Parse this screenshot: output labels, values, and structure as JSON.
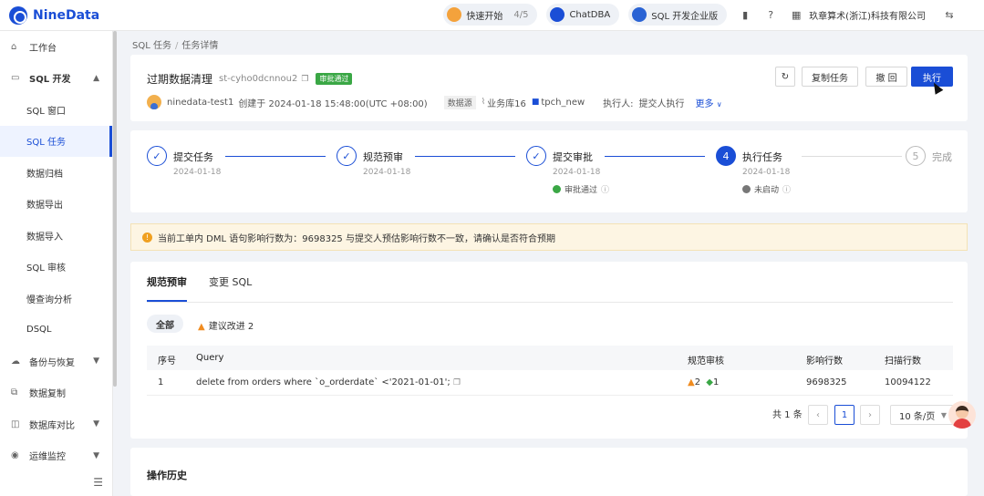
{
  "app": {
    "logo_text": "NineData",
    "brand_color": "#1a4ed6"
  },
  "topbar": {
    "quick_start_label": "快速开始",
    "quick_start_progress": "4/5",
    "chatdba_label": "ChatDBA",
    "edition_label": "SQL 开发企业版",
    "company": "玖章算术(浙江)科技有限公司"
  },
  "sidebar": {
    "items": [
      {
        "label": "工作台",
        "icon": "home-icon"
      },
      {
        "label": "SQL 开发",
        "icon": "monitor-icon"
      },
      {
        "label": "SQL 窗口"
      },
      {
        "label": "SQL 任务"
      },
      {
        "label": "数据归档"
      },
      {
        "label": "数据导出"
      },
      {
        "label": "数据导入"
      },
      {
        "label": "SQL 审核"
      },
      {
        "label": "慢查询分析"
      },
      {
        "label": "DSQL"
      },
      {
        "label": "备份与恢复",
        "icon": "cloud-icon"
      },
      {
        "label": "数据复制",
        "icon": "copy-icon"
      },
      {
        "label": "数据库对比",
        "icon": "compare-icon"
      },
      {
        "label": "运维监控",
        "icon": "monitor-icon"
      }
    ]
  },
  "breadcrumb": {
    "parent": "SQL 任务",
    "separator": "/",
    "current": "任务详情"
  },
  "task": {
    "title": "过期数据清理",
    "id": "st-cyho0dcnnou2",
    "status_badge": "审批通过",
    "creator": "ninedata-test1",
    "created_text": "创建于 2024-01-18 15:48:00(UTC +08:00)",
    "datasource_tag": "数据源",
    "db_name": "业务库16",
    "schema_name": "tpch_new",
    "executor_label": "执行人:",
    "executor_value": "提交人执行",
    "more_label": "更多"
  },
  "actions": {
    "copy_task": "复制任务",
    "revoke": "撤 回",
    "execute": "执行"
  },
  "steps": [
    {
      "title": "提交任务",
      "date": "2024-01-18",
      "state": "done"
    },
    {
      "title": "规范预审",
      "date": "2024-01-18",
      "state": "done"
    },
    {
      "title": "提交审批",
      "date": "2024-01-18",
      "state": "done",
      "status": "审批通过",
      "status_color": "#3aa745"
    },
    {
      "title": "执行任务",
      "date": "2024-01-18",
      "state": "current",
      "number": "4",
      "status": "未启动",
      "status_color": "#777777"
    },
    {
      "title": "完成",
      "state": "pending",
      "number": "5"
    }
  ],
  "alert": {
    "text": "当前工单内 DML 语句影响行数为：9698325 与提交人预估影响行数不一致，请确认是否符合预期"
  },
  "review": {
    "tabs": [
      "规范预审",
      "变更 SQL"
    ],
    "filter_all": "全部",
    "filter_suggestion": "建议改进 2",
    "columns": [
      "序号",
      "Query",
      "规范审核",
      "影响行数",
      "扫描行数"
    ],
    "rows": [
      {
        "no": "1",
        "query": "delete from orders where `o_orderdate` <'2021-01-01';",
        "warn_count": "2",
        "pass_count": "1",
        "affected": "9698325",
        "scanned": "10094122"
      }
    ],
    "pagination": {
      "total": "共 1 条",
      "page": "1",
      "page_size": "10 条/页"
    }
  },
  "history": {
    "title": "操作历史"
  }
}
